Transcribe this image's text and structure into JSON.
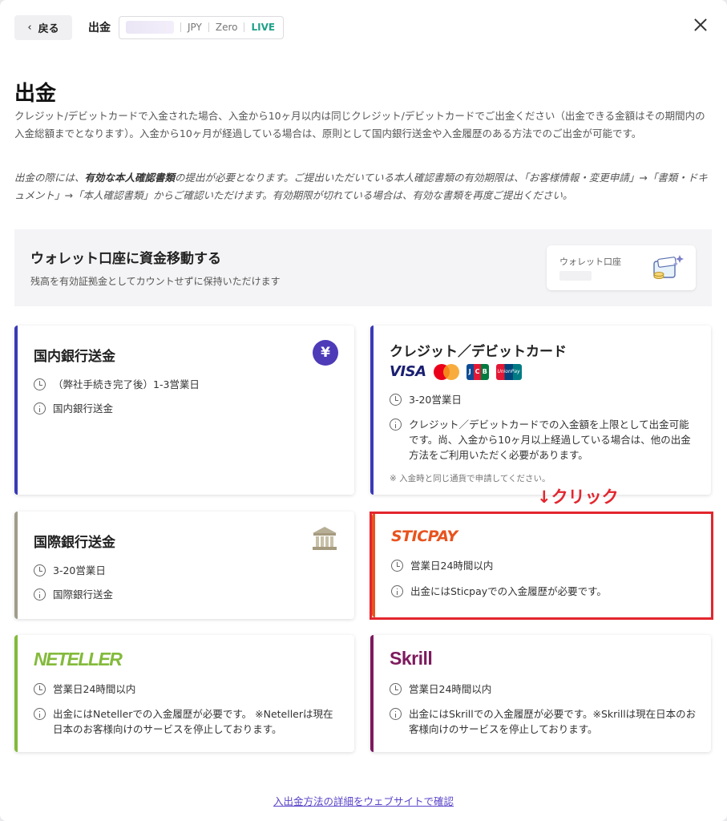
{
  "header": {
    "back_label": "戻る",
    "title": "出金",
    "account": {
      "currency": "JPY",
      "type": "Zero",
      "status": "LIVE"
    }
  },
  "page": {
    "title": "出金",
    "intro": "クレジット/デビットカードで入金された場合、入金から10ヶ月以内は同じクレジット/デビットカードでご出金ください（出金できる金額はその期間内の入金総額までとなります）。入金から10ヶ月が経過している場合は、原則として国内銀行送金や入金履歴のある方法でのご出金が可能です。",
    "notice_pre": "出金の際には、",
    "notice_bold": "有効な本人確認書類",
    "notice_post": "の提出が必要となります。ご提出いただいている本人確認書類の有効期限は、「お客様情報・変更申請」→「書類・ドキュメント」→「本人確認書類」からご確認いただけます。有効期限が切れている場合は、有効な書類を再度ご提出ください。"
  },
  "wallet": {
    "title": "ウォレット口座に資金移動する",
    "subtitle": "残高を有効証拠金としてカウントせずに保持いただけます",
    "card_label": "ウォレット口座"
  },
  "methods": {
    "domestic": {
      "title": "国内銀行送金",
      "icon": "yen-icon",
      "time": "（弊社手続き完了後）1-3営業日",
      "info": "国内銀行送金",
      "accent": "#3a3ab8"
    },
    "card": {
      "title": "クレジット／デビットカード",
      "brands": [
        "VISA",
        "JCB",
        "UnionPay"
      ],
      "time": "3-20営業日",
      "info": "クレジット／デビットカードでの入金額を上限として出金可能です。尚、入金から10ヶ月以上経過している場合は、他の出金方法をご利用いただく必要があります。",
      "note": "※ 入金時と同じ通貨で申請してください。",
      "accent": "#3a3ab8"
    },
    "international": {
      "title": "国際銀行送金",
      "icon": "bank-icon",
      "time": "3-20営業日",
      "info": "国際銀行送金",
      "accent": "#a09c8c"
    },
    "sticpay": {
      "logo": "STICPAY",
      "time": "営業日24時間以内",
      "info": "出金にはSticpayでの入金履歴が必要です。",
      "accent": "#e8531e"
    },
    "neteller": {
      "logo": "NETELLER",
      "time": "営業日24時間以内",
      "info": "出金にはNetellerでの入金履歴が必要です。 ※Netellerは現在日本のお客様向けのサービスを停止しております。",
      "accent": "#83ba3b"
    },
    "skrill": {
      "logo": "Skrill",
      "time": "営業日24時間以内",
      "info": "出金にはSkrillでの入金履歴が必要です。※Skrillは現在日本のお客様向けのサービスを停止しております。",
      "accent": "#7d1a5e"
    }
  },
  "annotation": {
    "label": "↓クリック",
    "color": "#e3262e"
  },
  "footer": {
    "link": "入出金方法の詳細をウェブサイトで確認"
  }
}
